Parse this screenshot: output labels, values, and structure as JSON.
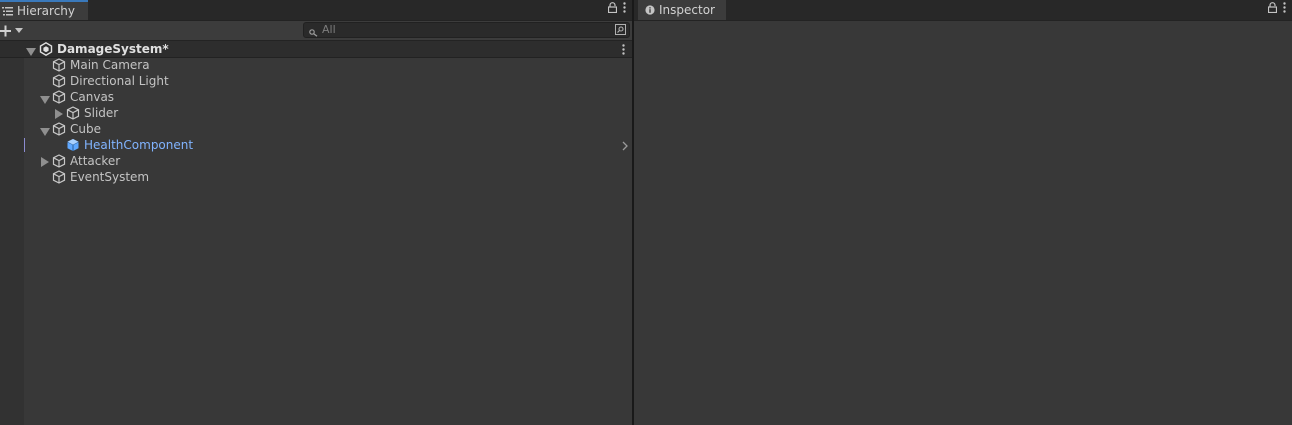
{
  "hierarchy": {
    "tab_label": "Hierarchy",
    "search_placeholder": "All",
    "scene_name": "DamageSystem*",
    "items": [
      {
        "label": "Main Camera"
      },
      {
        "label": "Directional Light"
      },
      {
        "label": "Canvas"
      },
      {
        "label": "Slider"
      },
      {
        "label": "Cube"
      },
      {
        "label": "HealthComponent"
      },
      {
        "label": "Attacker"
      },
      {
        "label": "EventSystem"
      }
    ]
  },
  "inspector": {
    "tab_label": "Inspector"
  },
  "colors": {
    "accent": "#3a79bb",
    "prefab": "#81b4ff",
    "panel_bg": "#383838"
  }
}
